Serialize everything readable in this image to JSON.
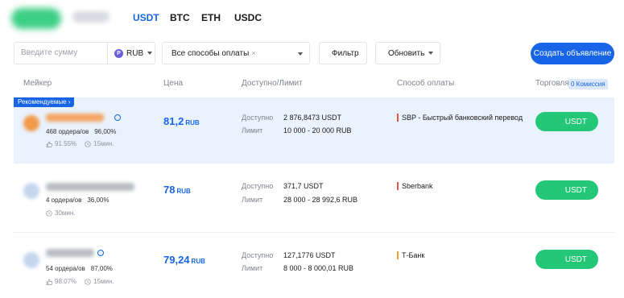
{
  "colors": {
    "accent": "#1765e6",
    "buy": "#23c777",
    "recommended_bg": "#eaf2fd"
  },
  "tabs": [
    {
      "label": "USDT",
      "active": true
    },
    {
      "label": "BTC",
      "active": false
    },
    {
      "label": "ETH",
      "active": false
    },
    {
      "label": "USDC",
      "active": false
    }
  ],
  "filters": {
    "amount_placeholder": "Введите сумму",
    "currency": "RUB",
    "currency_icon": "P",
    "payment_method": "Все способы оплаты",
    "payment_clear": "×",
    "filter_label": "Фильтр",
    "refresh_label": "Обновить",
    "create_ad_label": "Создать объявление"
  },
  "table": {
    "headers": {
      "maker": "Мейкер",
      "price": "Цена",
      "available": "Доступно/Лимит",
      "payment": "Способ оплаты",
      "trade": "Торговля",
      "commission": "0 Комиссия"
    },
    "recommended_label": "Рекомендуемые ›",
    "available_label": "Доступно",
    "limit_label": "Лимит",
    "rows": [
      {
        "orders": "468 ордера/ов",
        "completion": "96,00%",
        "rating": "91.55%",
        "time": "15мин.",
        "price": "81,2",
        "price_currency": "RUB",
        "available": "2 876,8473 USDT",
        "limit": "10 000 - 20 000 RUB",
        "payment": "SBP - Быстрый банковский перевод",
        "action": "USDT"
      },
      {
        "orders": "4 ордера/ов",
        "completion": "36,00%",
        "rating": "",
        "time": "30мин.",
        "price": "78",
        "price_currency": "RUB",
        "available": "371,7 USDT",
        "limit": "28 000 - 28 992,6 RUB",
        "payment": "Sberbank",
        "action": "USDT"
      },
      {
        "orders": "54 ордера/ов",
        "completion": "87,00%",
        "rating": "98.07%",
        "time": "15мин.",
        "price": "79,24",
        "price_currency": "RUB",
        "available": "127,1776 USDT",
        "limit": "8 000 - 8 000,01 RUB",
        "payment": "Т-Банк",
        "action": "USDT"
      }
    ]
  }
}
